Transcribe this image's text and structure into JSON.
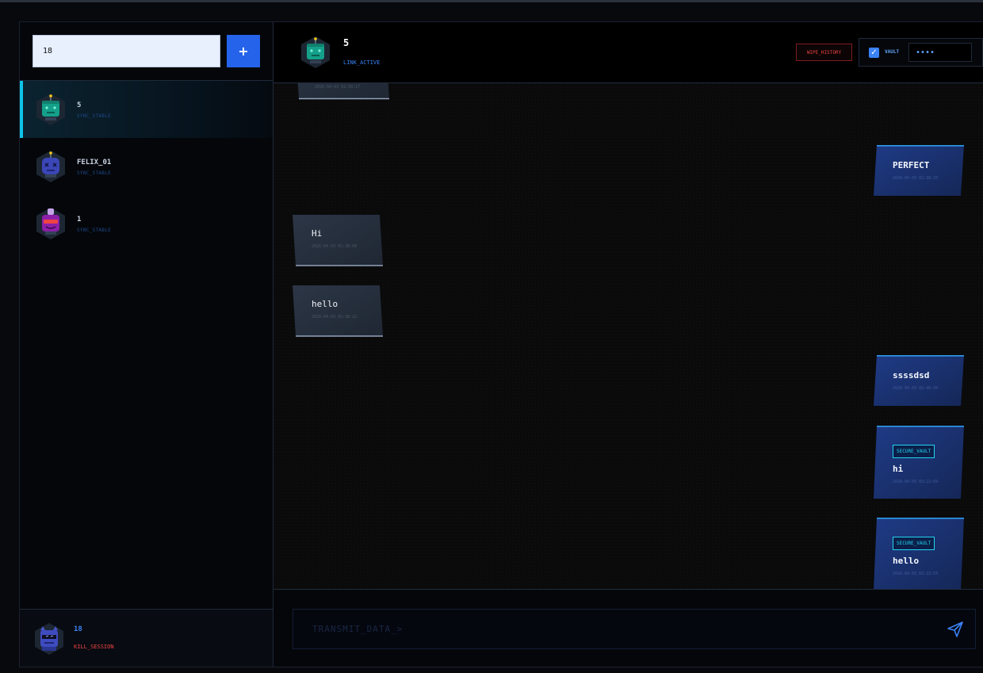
{
  "sidebar": {
    "new_contact_input": {
      "value": "18"
    },
    "add_button_label": "+",
    "contacts": [
      {
        "name": "5",
        "status": "SYNC_STABLE",
        "active": true,
        "avatar": "teal-robot-icon"
      },
      {
        "name": "FELIX_01",
        "status": "SYNC_STABLE",
        "active": false,
        "avatar": "blue-robot-icon"
      },
      {
        "name": "1",
        "status": "SYNC_STABLE",
        "active": false,
        "avatar": "purple-robot-icon"
      }
    ],
    "me": {
      "name": "18",
      "action": "KILL_SESSION",
      "avatar": "indigo-robot-icon"
    }
  },
  "header": {
    "name": "5",
    "status": "LINK_ACTIVE",
    "wipe_label": "WIPE_HISTORY",
    "vault_label": "VAULT",
    "vault_checked": true,
    "vault_key": "••••"
  },
  "messages": [
    {
      "side": "received",
      "text": "",
      "time": "2026-04-03 02:30:17",
      "vault": false
    },
    {
      "side": "sent",
      "text": "PERFECT",
      "time": "2026-04-03 02:38:25",
      "vault": false
    },
    {
      "side": "received",
      "text": "Hi",
      "time": "2026-04-03 02:38:08",
      "vault": false
    },
    {
      "side": "received",
      "text": "hello",
      "time": "2026-04-03 02:38:22",
      "vault": false
    },
    {
      "side": "sent",
      "text": "ssssdsd",
      "time": "2026-04-03 02:40:34",
      "vault": false
    },
    {
      "side": "sent",
      "text": "hi",
      "time": "2026-04-03 03:22:04",
      "vault": true,
      "vault_tag": "SECURE_VAULT"
    },
    {
      "side": "sent",
      "text": "hello",
      "time": "2026-04-03 03:22:53",
      "vault": true,
      "vault_tag": "SECURE_VAULT"
    }
  ],
  "composer": {
    "placeholder": "TRANSMIT_DATA_>"
  },
  "colors": {
    "accent": "#2563eb",
    "active_bar": "#0ec3e8",
    "danger": "#ef4444",
    "vault_tag": "#22d3ee",
    "sent_bubble": "#1c3578",
    "received_bubble": "#283242"
  }
}
